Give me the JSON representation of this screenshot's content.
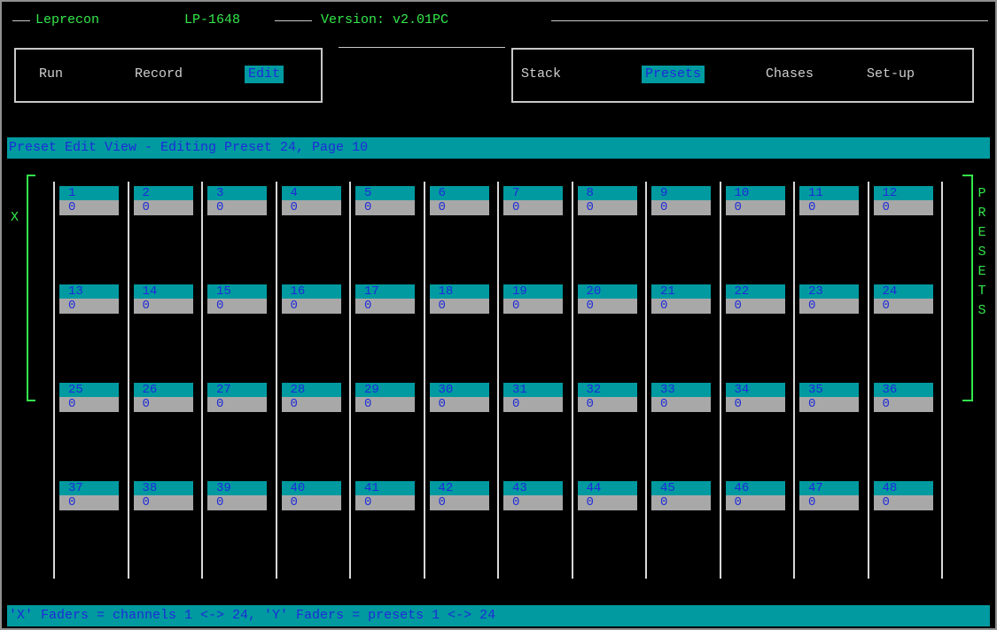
{
  "title": {
    "app": "Leprecon",
    "model": "LP-1648",
    "version": "Version: v2.01PC"
  },
  "left_menu": {
    "items": [
      {
        "label": "Run",
        "active": false
      },
      {
        "label": "Record",
        "active": false
      },
      {
        "label": "Edit",
        "active": true
      }
    ]
  },
  "right_menu": {
    "items": [
      {
        "label": "Stack",
        "active": false
      },
      {
        "label": "Presets",
        "active": true
      },
      {
        "label": "Chases",
        "active": false
      },
      {
        "label": "Set-up",
        "active": false
      }
    ]
  },
  "header_bar": "Preset Edit View - Editing Preset 24, Page 10",
  "x_label": "X",
  "side_label": [
    "P",
    "R",
    "E",
    "S",
    "E",
    "T",
    "S"
  ],
  "presets": [
    {
      "num": "1",
      "val": "0"
    },
    {
      "num": "2",
      "val": "0"
    },
    {
      "num": "3",
      "val": "0"
    },
    {
      "num": "4",
      "val": "0"
    },
    {
      "num": "5",
      "val": "0"
    },
    {
      "num": "6",
      "val": "0"
    },
    {
      "num": "7",
      "val": "0"
    },
    {
      "num": "8",
      "val": "0"
    },
    {
      "num": "9",
      "val": "0"
    },
    {
      "num": "10",
      "val": "0"
    },
    {
      "num": "11",
      "val": "0"
    },
    {
      "num": "12",
      "val": "0"
    },
    {
      "num": "13",
      "val": "0"
    },
    {
      "num": "14",
      "val": "0"
    },
    {
      "num": "15",
      "val": "0"
    },
    {
      "num": "16",
      "val": "0"
    },
    {
      "num": "17",
      "val": "0"
    },
    {
      "num": "18",
      "val": "0"
    },
    {
      "num": "19",
      "val": "0"
    },
    {
      "num": "20",
      "val": "0"
    },
    {
      "num": "21",
      "val": "0"
    },
    {
      "num": "22",
      "val": "0"
    },
    {
      "num": "23",
      "val": "0"
    },
    {
      "num": "24",
      "val": "0"
    },
    {
      "num": "25",
      "val": "0"
    },
    {
      "num": "26",
      "val": "0"
    },
    {
      "num": "27",
      "val": "0"
    },
    {
      "num": "28",
      "val": "0"
    },
    {
      "num": "29",
      "val": "0"
    },
    {
      "num": "30",
      "val": "0"
    },
    {
      "num": "31",
      "val": "0"
    },
    {
      "num": "32",
      "val": "0"
    },
    {
      "num": "33",
      "val": "0"
    },
    {
      "num": "34",
      "val": "0"
    },
    {
      "num": "35",
      "val": "0"
    },
    {
      "num": "36",
      "val": "0"
    },
    {
      "num": "37",
      "val": "0"
    },
    {
      "num": "38",
      "val": "0"
    },
    {
      "num": "39",
      "val": "0"
    },
    {
      "num": "40",
      "val": "0"
    },
    {
      "num": "41",
      "val": "0"
    },
    {
      "num": "42",
      "val": "0"
    },
    {
      "num": "43",
      "val": "0"
    },
    {
      "num": "44",
      "val": "0"
    },
    {
      "num": "45",
      "val": "0"
    },
    {
      "num": "46",
      "val": "0"
    },
    {
      "num": "47",
      "val": "0"
    },
    {
      "num": "48",
      "val": "0"
    }
  ],
  "footer_bar": "'X' Faders = channels 1 <-> 24, 'Y' Faders = presets 1 <-> 24",
  "colors": {
    "background": "#000000",
    "teal": "#009aa0",
    "text_blue": "#1e2bd8",
    "green": "#33e84a",
    "gray": "#a8a8a8"
  }
}
